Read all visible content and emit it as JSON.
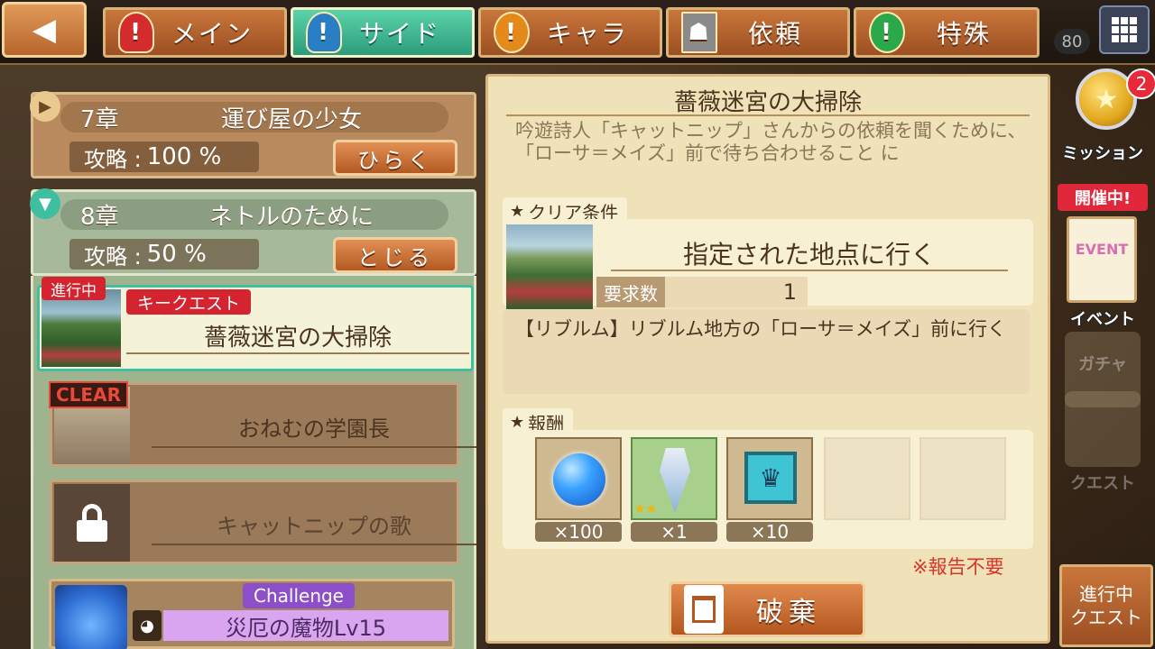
{
  "nav": {
    "tabs": [
      {
        "label": "メイン",
        "icon": "!"
      },
      {
        "label": "サイド",
        "icon": "!"
      },
      {
        "label": "キャラ",
        "icon": "!"
      },
      {
        "label": "依頼",
        "icon": "☗"
      },
      {
        "label": "特殊",
        "icon": "!"
      }
    ],
    "count": "80"
  },
  "chapters": [
    {
      "num": "7章",
      "name": "運び屋の少女",
      "progress_label": "攻略 :",
      "progress": "100 %",
      "button": "ひらく"
    },
    {
      "num": "8章",
      "name": "ネトルのために",
      "progress_label": "攻略 :",
      "progress": "50 %",
      "button": "とじる"
    }
  ],
  "quests": {
    "selected": {
      "status": "進行中",
      "kind": "キークエスト",
      "name": "薔薇迷宮の大掃除"
    },
    "cleared": {
      "tag": "CLEAR",
      "name": "おねむの学園長"
    },
    "locked": {
      "name": "キャットニップの歌"
    },
    "challenge": {
      "badge": "Challenge",
      "name": "災厄の魔物Lv15"
    }
  },
  "detail": {
    "title": "薔薇迷宮の大掃除",
    "description": "吟遊詩人「キャットニップ」さんからの依頼を聞くために、「ローサ＝メイズ」前で待ち合わせること に",
    "clear_heading": "クリア条件",
    "condition": "指定された地点に行く",
    "req_label": "要求数",
    "req_value": "1",
    "condition_detail": "【リブルム】リブルム地方の「ローサ＝メイズ」前に行く",
    "reward_heading": "報酬",
    "rewards": [
      {
        "qty": "×100"
      },
      {
        "qty": "×1"
      },
      {
        "qty": "×10"
      }
    ],
    "no_report": "※報告不要",
    "discard": "破棄"
  },
  "rail": {
    "mission_label": "ミッション",
    "mission_badge": "2",
    "event_tag": "開催中!",
    "event_card": "EVENT",
    "event_label": "イベント",
    "gacha_label": "ガチャ",
    "quest_label": "クエスト",
    "inprogress": "進行中\nクエスト"
  },
  "colors": {
    "active_tab": "#2b9c7a",
    "tab": "#b35a22",
    "red_tag": "#d4242f"
  }
}
